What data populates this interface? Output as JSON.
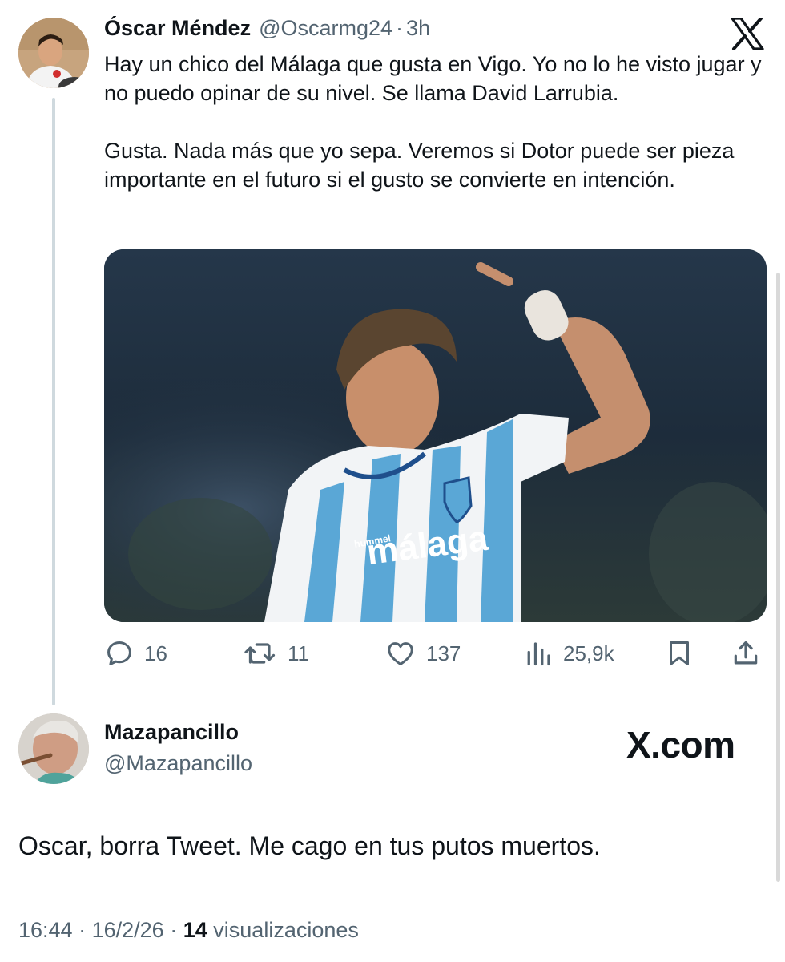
{
  "tweet": {
    "author_name": "Óscar Méndez",
    "handle": "@Oscarmg24",
    "separator": "·",
    "time": "3h",
    "text": "Hay un chico del Málaga que gusta en Vigo. Yo no lo he visto jugar y no puedo opinar de su nivel. Se llama David Larrubia.\n\nGusta. Nada más que yo sepa. Veremos si Dotor puede ser pieza importante en el futuro si el gusto se convierte en intención.",
    "media": {
      "jersey_wordmark": "málaga",
      "kit_brand": "hummel"
    },
    "actions": {
      "replies": "16",
      "retweets": "11",
      "likes": "137",
      "views": "25,9k"
    }
  },
  "reply": {
    "author_name": "Mazapancillo",
    "handle": "@Mazapancillo",
    "brand": "X.com",
    "text": "Oscar, borra Tweet. Me cago en tus putos muertos.",
    "time": "16:44",
    "date": "16/2/26",
    "views_count": "14",
    "views_label": "visualizaciones",
    "separator": "·"
  },
  "colors": {
    "text": "#0f1419",
    "muted": "#536471",
    "thread_line": "#cfd9de",
    "jersey_blue": "#5aa7d6"
  }
}
